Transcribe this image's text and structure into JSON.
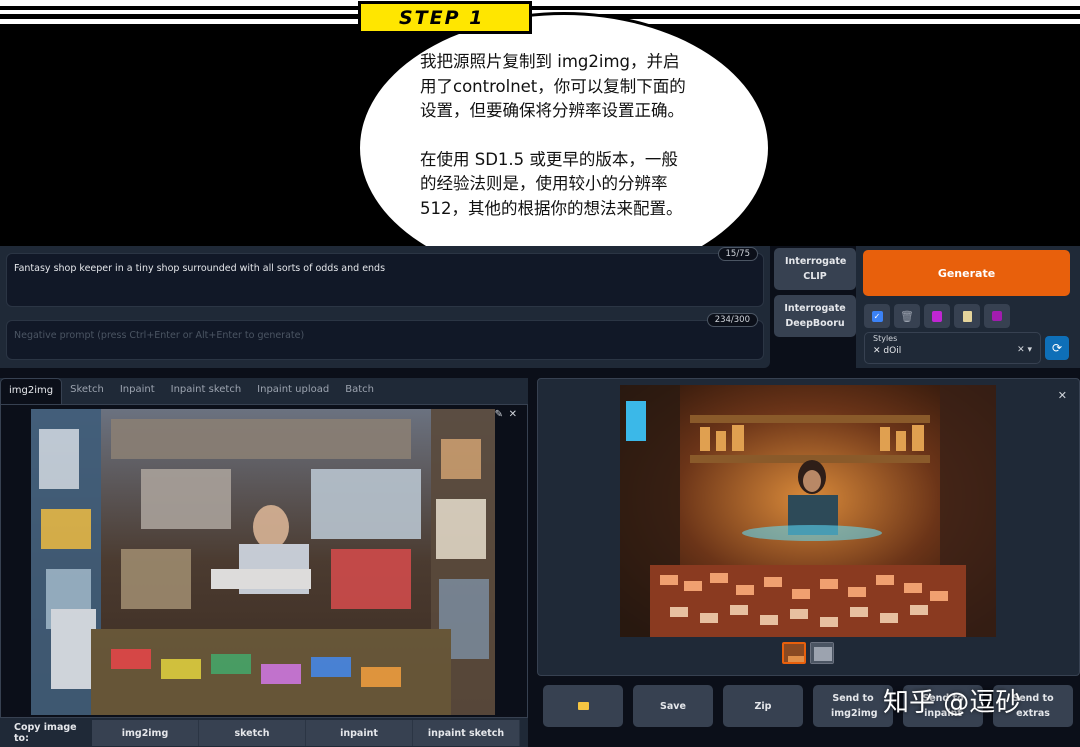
{
  "banner": {
    "step_label": "STEP 1",
    "bubble_lines_1": [
      "我把源照片复制到 img2img，并启",
      "用了controlnet，你可以复制下面的",
      "设置，但要确保将分辨率设置正确。"
    ],
    "bubble_lines_2": [
      "在使用 SD1.5 或更早的版本，一般",
      "的经验法则是，使用较小的分辨率",
      "512，其他的根据你的想法来配置。"
    ]
  },
  "prompt": {
    "positive_text": "Fantasy shop keeper in a tiny shop surrounded with all sorts of odds and ends",
    "positive_counter": "15/75",
    "negative_placeholder": "Negative prompt (press Ctrl+Enter or Alt+Enter to generate)",
    "negative_counter": "234/300"
  },
  "buttons": {
    "interrogate_clip": "Interrogate CLIP",
    "interrogate_deepbooru": "Interrogate DeepBooru",
    "generate": "Generate"
  },
  "styles": {
    "label": "Styles",
    "selected": "dOil"
  },
  "tabs": [
    "img2img",
    "Sketch",
    "Inpaint",
    "Inpaint sketch",
    "Inpaint upload",
    "Batch"
  ],
  "copy_row": {
    "label": "Copy image to:",
    "targets": [
      "img2img",
      "sketch",
      "inpaint",
      "inpaint sketch"
    ]
  },
  "output_buttons": [
    "Save",
    "Zip",
    "Send to img2img",
    "Send to inpaint",
    "Send to extras"
  ],
  "watermark": "知乎 @逗砂",
  "colors": {
    "generate": "#e8600c",
    "background": "#0b0f19",
    "panel": "#1f2937",
    "button": "#374151",
    "banner_yellow": "#ffe600"
  }
}
